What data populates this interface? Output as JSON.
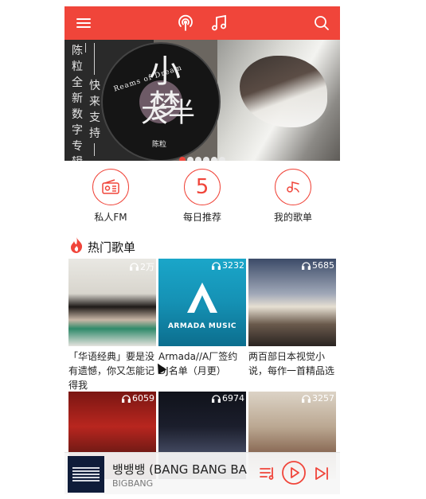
{
  "colors": {
    "accent": "#f0453a",
    "topbar": "#f0453a"
  },
  "topbar": {
    "menu_icon": "menu-icon",
    "podcast_icon": "podcast-icon",
    "music_icon": "music-note-icon",
    "search_icon": "search-icon"
  },
  "banner": {
    "vertical_col1": "陈粒全新数字专辑",
    "vertical_col2": "快来支持",
    "title_sub": "Reams of Dream",
    "title_main_1": "小梦",
    "title_main_2": "大半",
    "signature": "陈粒",
    "dot_count": 6,
    "active_dot": 0
  },
  "quick": [
    {
      "label": "私人FM",
      "icon": "radio-icon"
    },
    {
      "label": "每日推荐",
      "icon": "calendar-5-icon",
      "num": "5"
    },
    {
      "label": "我的歌单",
      "icon": "music-list-icon"
    }
  ],
  "section": {
    "title": "热门歌单",
    "icon": "flame-icon"
  },
  "playlists": [
    {
      "count": "2万",
      "title": "「华语经典」要是没有遗憾，你又怎能记得我"
    },
    {
      "count": "3232",
      "title": "Armada//A厂签约DJ名单（月更）",
      "cover_text": "ARMADA MUSIC"
    },
    {
      "count": "5685",
      "title": "两百部日本视觉小说，每作一首精品选"
    },
    {
      "count": "6059",
      "title": ""
    },
    {
      "count": "6974",
      "title": ""
    },
    {
      "count": "3257",
      "title": ""
    }
  ],
  "player": {
    "title": "뱅뱅뱅 (BANG BANG BANG)",
    "artist": "BIGBANG"
  }
}
